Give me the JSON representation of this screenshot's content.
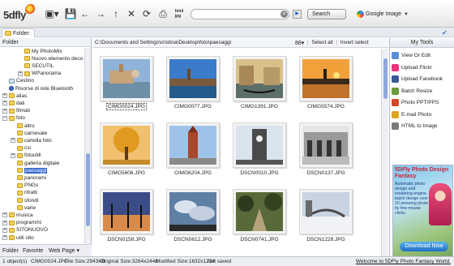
{
  "app": {
    "logo_text": "5dfly"
  },
  "toolbar": {
    "buttons": [
      {
        "name": "screen-menu-icon",
        "glyph": "▣▾"
      },
      {
        "name": "save-icon",
        "glyph": "💾"
      },
      {
        "name": "back-icon",
        "glyph": "←"
      },
      {
        "name": "forward-icon",
        "glyph": "→"
      },
      {
        "name": "up-icon",
        "glyph": "↑"
      },
      {
        "name": "delete-icon",
        "glyph": "✕"
      },
      {
        "name": "refresh-icon",
        "glyph": "⟳"
      },
      {
        "name": "print-icon",
        "glyph": "⎙"
      },
      {
        "name": "html-jpg-icon",
        "glyph": "html\njpg"
      }
    ],
    "search_value": "",
    "search_label": "Search",
    "engine_label": "Google Image"
  },
  "tabs": {
    "folder_tab": "Folder"
  },
  "left_panel": {
    "header": "Folder",
    "tree": [
      {
        "label": "My PhotoMix",
        "indent": 3,
        "expander": "",
        "icon": "folder"
      },
      {
        "label": "Nuovo elemento deco",
        "indent": 3,
        "expander": "",
        "icon": "folder"
      },
      {
        "label": "SECUTIL",
        "indent": 3,
        "expander": "",
        "icon": "folder"
      },
      {
        "label": "WPanorama",
        "indent": 3,
        "expander": "+",
        "icon": "folder"
      },
      {
        "label": "Cestino",
        "indent": 1,
        "expander": "",
        "icon": "bin"
      },
      {
        "label": "Risorse di rete Bluetooth",
        "indent": 1,
        "expander": "",
        "icon": "bt"
      },
      {
        "label": "alias",
        "indent": 1,
        "expander": "+",
        "icon": "folder"
      },
      {
        "label": "dati",
        "indent": 1,
        "expander": "+",
        "icon": "folder"
      },
      {
        "label": "filmati",
        "indent": 1,
        "expander": "+",
        "icon": "folder"
      },
      {
        "label": "foto",
        "indent": 1,
        "expander": "−",
        "icon": "folder"
      },
      {
        "label": "altro",
        "indent": 2,
        "expander": "",
        "icon": "folder"
      },
      {
        "label": "carnevale",
        "indent": 2,
        "expander": "",
        "icon": "folder"
      },
      {
        "label": "cartella foto",
        "indent": 2,
        "expander": "+",
        "icon": "folder"
      },
      {
        "label": "csi",
        "indent": 2,
        "expander": "",
        "icon": "folder"
      },
      {
        "label": "fotoutili",
        "indent": 2,
        "expander": "+",
        "icon": "folder"
      },
      {
        "label": "galleria digitale",
        "indent": 2,
        "expander": "",
        "icon": "folder"
      },
      {
        "label": "paesaggi",
        "indent": 2,
        "expander": "",
        "icon": "folder",
        "selected": true
      },
      {
        "label": "panorami",
        "indent": 2,
        "expander": "",
        "icon": "folder"
      },
      {
        "label": "PNGs",
        "indent": 2,
        "expander": "",
        "icon": "folder"
      },
      {
        "label": "ritratti",
        "indent": 2,
        "expander": "",
        "icon": "folder"
      },
      {
        "label": "sfondi",
        "indent": 2,
        "expander": "",
        "icon": "folder"
      },
      {
        "label": "varie",
        "indent": 2,
        "expander": "",
        "icon": "folder"
      },
      {
        "label": "musica",
        "indent": 1,
        "expander": "+",
        "icon": "folder"
      },
      {
        "label": "programmi",
        "indent": 1,
        "expander": "+",
        "icon": "folder"
      },
      {
        "label": "SITONUOVO",
        "indent": 1,
        "expander": "+",
        "icon": "folder"
      },
      {
        "label": "utili sito",
        "indent": 1,
        "expander": "+",
        "icon": "folder"
      }
    ],
    "bottom_tabs": [
      "Folder",
      "Favorite",
      "Web Page ▾"
    ]
  },
  "center": {
    "path": "C:\\Documents and Settings\\cristina\\Desktop\\foto\\paesaggi",
    "view_label": "88▾",
    "select_all": "Select all",
    "invert_select": "Invert select",
    "thumbnails": [
      {
        "name": "CIMG0024.JPG",
        "selected": true,
        "scene": "venice-day"
      },
      {
        "name": "CIMG0077.JPG",
        "selected": false,
        "scene": "venice-sky"
      },
      {
        "name": "CIMG1391.JPG",
        "selected": false,
        "scene": "venice-gondola"
      },
      {
        "name": "CIMG5574.JPG",
        "selected": false,
        "scene": "venice-sunset"
      },
      {
        "name": "CIMG5606.JPG",
        "selected": false,
        "scene": "autumn-tree"
      },
      {
        "name": "CIMG6204.JPG",
        "selected": false,
        "scene": "bell-tower"
      },
      {
        "name": "DSCN0010.JPG",
        "selected": false,
        "scene": "clock-tower"
      },
      {
        "name": "DSCN0137.JPG",
        "selected": false,
        "scene": "arcade"
      },
      {
        "name": "DSCN0158.JPG",
        "selected": false,
        "scene": "dusk-poles"
      },
      {
        "name": "DSCN0612.JPG",
        "selected": false,
        "scene": "clouds"
      },
      {
        "name": "DSCN0741.JPG",
        "selected": false,
        "scene": "tree-road"
      },
      {
        "name": "DSCN1228.JPG",
        "selected": false,
        "scene": "snow-bridge"
      }
    ]
  },
  "right_panel": {
    "header": "My Tools",
    "tools": [
      {
        "label": "View Or Edit",
        "icon": "view-edit-icon",
        "color": "#5a8fd6"
      },
      {
        "label": "Upload Flickr",
        "icon": "flickr-icon",
        "color": "#e8337b"
      },
      {
        "label": "Upload Facebook",
        "icon": "facebook-icon",
        "color": "#3b5998"
      },
      {
        "label": "Batch Resize",
        "icon": "batch-resize-icon",
        "color": "#6a9a3a"
      },
      {
        "label": "Photo PPT/PPS",
        "icon": "ppt-icon",
        "color": "#d24726"
      },
      {
        "label": "E-mail Photo",
        "icon": "email-icon",
        "color": "#d9a520"
      },
      {
        "label": "HTML to Image",
        "icon": "html-image-icon",
        "color": "#7a7a7a"
      }
    ],
    "ad": {
      "title": "5DFly Photo Design Fantasy",
      "text": "Automatic photo design and rendering engine, batch design over 10 amazing photo by few mouse clicks.",
      "button": "Download Now"
    }
  },
  "statusbar": {
    "objects": "1 object(s)",
    "file": "CIMG0024.JPG",
    "file_size": "File Size:2943KB",
    "original_size": "Original Size:3264x2448",
    "modified_size": "Modified Size:1632x1224",
    "saved": "Not saved",
    "link": "Welcome to 5DFly Photo Fantasy World."
  }
}
